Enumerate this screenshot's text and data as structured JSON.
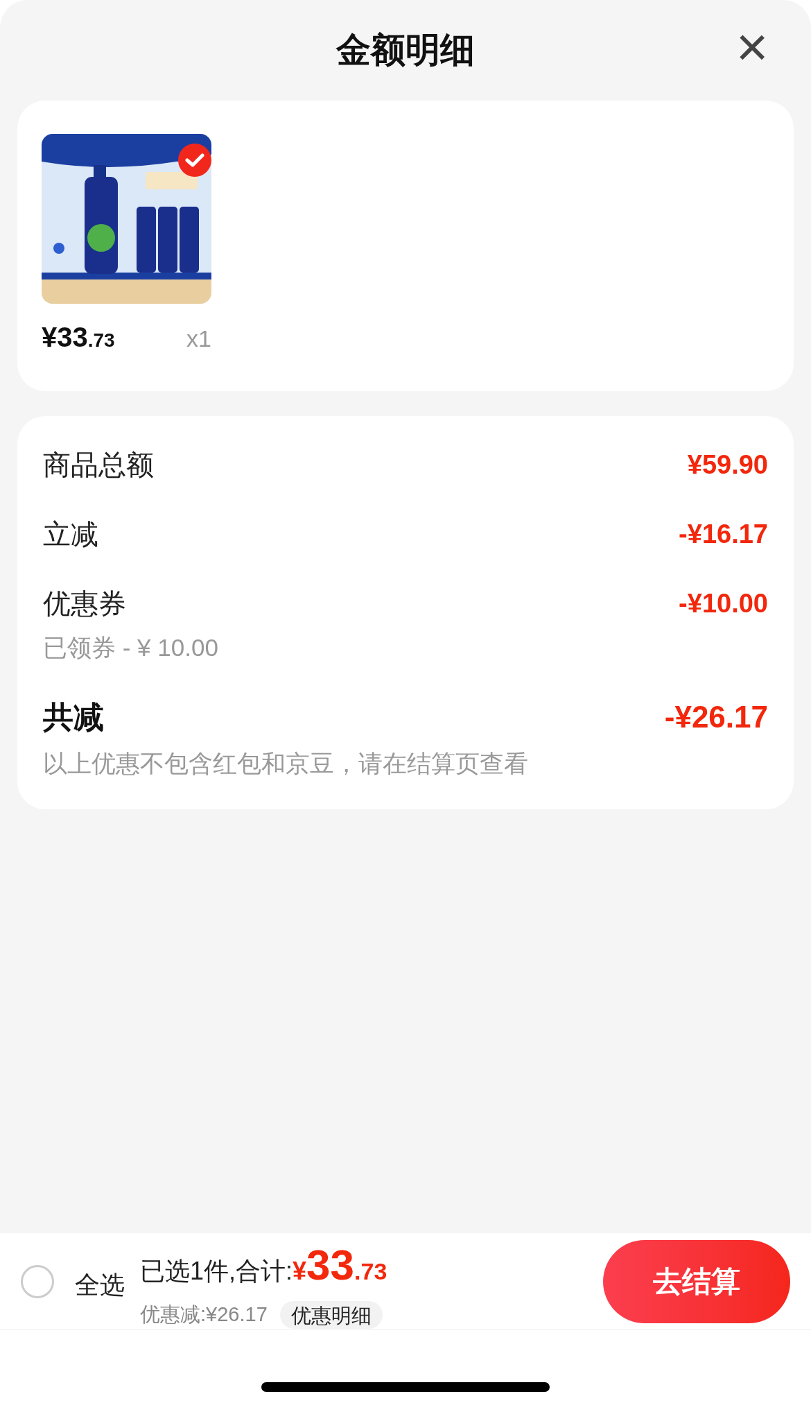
{
  "header": {
    "title": "金额明细",
    "close": "×"
  },
  "items": [
    {
      "kind": "picture",
      "selected": true,
      "price_integer": "¥33",
      "price_decimal": ".73",
      "quantity": "x1"
    }
  ],
  "breakdown": [
    {
      "kind": "normal",
      "label": "商品总额",
      "amount": "¥59.90"
    },
    {
      "kind": "normal",
      "label": "立减",
      "amount": "-¥16.17"
    },
    {
      "kind": "normal",
      "label": "优惠券",
      "amount": "-¥10.00",
      "note": "已领券 - ¥ 10.00"
    },
    {
      "kind": "total",
      "label": "共减",
      "amount": "-¥26.17",
      "note": "以上优惠不包含红包和京豆，请在结算页查看"
    }
  ],
  "bottom_bar": {
    "select_all": {
      "label": "全选",
      "checked": false
    },
    "summary": "已选1件,合计:",
    "total_currency": "¥",
    "total_integer": "33",
    "total_decimal": ".73",
    "discount": "优惠减:¥26.17",
    "details_button": "优惠明细",
    "checkout_button": "去结算"
  }
}
